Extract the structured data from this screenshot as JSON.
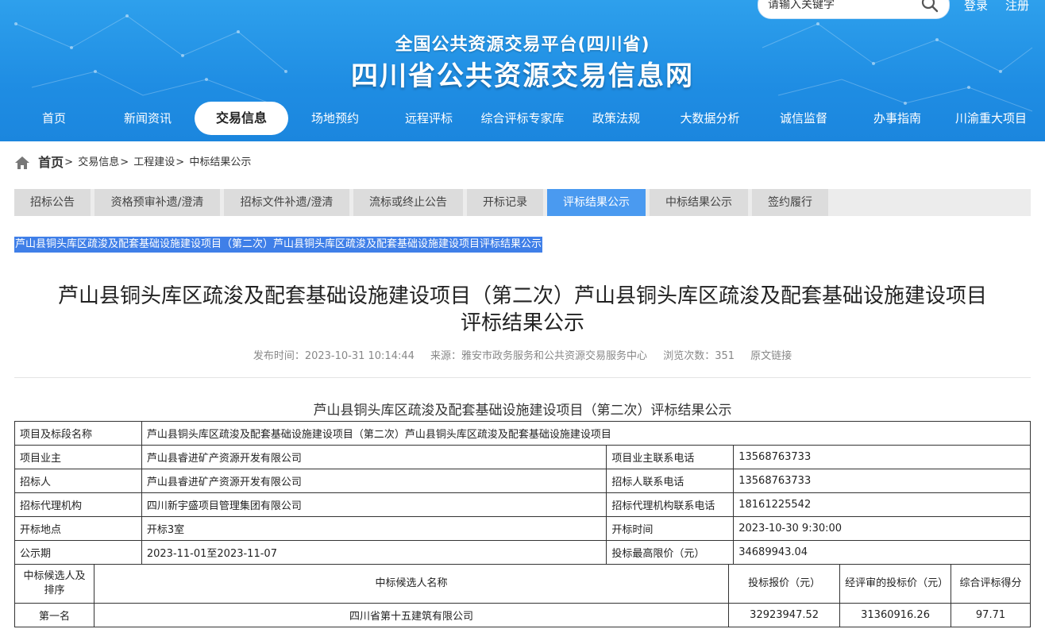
{
  "header": {
    "search_placeholder": "请输入关键字",
    "login": "登录",
    "register": "注册",
    "platform_name": "全国公共资源交易平台(四川省)",
    "site_title": "四川省公共资源交易信息网"
  },
  "nav": {
    "items": [
      "首页",
      "新闻资讯",
      "交易信息",
      "场地预约",
      "远程评标",
      "综合评标专家库",
      "政策法规",
      "大数据分析",
      "诚信监督",
      "办事指南",
      "川渝重大项目"
    ],
    "active": "交易信息"
  },
  "breadcrumb": {
    "home": "首页",
    "items": [
      "交易信息",
      "工程建设",
      "中标结果公示"
    ],
    "separator": ">"
  },
  "tabs": {
    "items": [
      "招标公告",
      "资格预审补遗/澄清",
      "招标文件补遗/澄清",
      "流标或终止公告",
      "开标记录",
      "评标结果公示",
      "中标结果公示",
      "签约履行"
    ],
    "active": "评标结果公示"
  },
  "highlight_title": "芦山县铜头库区疏浚及配套基础设施建设项目（第二次）芦山县铜头库区疏浚及配套基础设施建设项目评标结果公示",
  "article": {
    "title_line1": "芦山县铜头库区疏浚及配套基础设施建设项目（第二次）芦山县铜头库区疏浚及配套基础设施建设项目",
    "title_line2": "评标结果公示",
    "publish_time": "发布时间：2023-10-31 10:14:44",
    "source": "来源：雅安市政务服务和公共资源交易服务中心",
    "views": "浏览次数：351",
    "original_link": "原文链接"
  },
  "table": {
    "caption": "芦山县铜头库区疏浚及配套基础设施建设项目（第二次）评标结果公示",
    "project_label": "项目及标段名称",
    "project_value": "芦山县铜头库区疏浚及配套基础设施建设项目（第二次）芦山县铜头库区疏浚及配套基础设施建设项目",
    "rows": [
      {
        "l1": "项目业主",
        "v1": "芦山县睿进矿产资源开发有限公司",
        "l2": "项目业主联系电话",
        "v2": "13568763733"
      },
      {
        "l1": "招标人",
        "v1": "芦山县睿进矿产资源开发有限公司",
        "l2": "招标人联系电话",
        "v2": "13568763733"
      },
      {
        "l1": "招标代理机构",
        "v1": "四川新宇盛项目管理集团有限公司",
        "l2": "招标代理机构联系电话",
        "v2": "18161225542"
      },
      {
        "l1": "开标地点",
        "v1": "开标3室",
        "l2": "开标时间",
        "v2": "2023-10-30 9:30:00"
      },
      {
        "l1": "公示期",
        "v1": "2023-11-01至2023-11-07",
        "l2": "投标最高限价（元）",
        "v2": "34689943.04"
      }
    ],
    "candidates_header": {
      "rank": "中标候选人及排序",
      "name": "中标候选人名称",
      "bid": "投标报价（元）",
      "reviewed": "经评审的投标价（元）",
      "score": "综合评标得分"
    },
    "candidates": [
      {
        "rank": "第一名",
        "name": "四川省第十五建筑有限公司",
        "bid": "32923947.52",
        "reviewed": "31360916.26",
        "score": "97.71"
      }
    ]
  },
  "colors": {
    "header_blue": "#1f8de3",
    "tab_active": "#4a9af0",
    "highlight": "#3f7fe8"
  }
}
